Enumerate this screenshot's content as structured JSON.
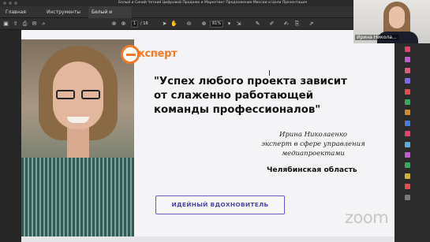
{
  "window": {
    "title": "Белый и Синий Четкий Цифровой Продажи и Маркетинг Предложение Миссии и Цели Презентация"
  },
  "tabs": [
    {
      "label": "Главная"
    },
    {
      "label": "Инструменты"
    },
    {
      "label": "Белый и Синий Ч...",
      "close": "×"
    }
  ],
  "toolbar": {
    "page_current": "1",
    "page_total": "/ 16",
    "zoom": "81%"
  },
  "slide": {
    "logo_word": "ксперт",
    "quote": "\"Успех любого проекта зависит от слаженно работающей команды профессионалов\"",
    "author_name": "Ирина Николаенко",
    "author_role": "эксперт в сфере управления медиапроектами",
    "region": "Челябинская область",
    "badge": "ИДЕЙНЫЙ ВДОХНОВИТЕЛЬ"
  },
  "webcam": {
    "participant_name": "Ирина Никола..."
  },
  "watermark": "zoom",
  "colors": {
    "accent_orange": "#f07a26",
    "badge_purple": "#4d46a8",
    "sidebar_icons": [
      "#e0446a",
      "#c05ad6",
      "#e35a78",
      "#7a6af0",
      "#e44d4d",
      "#3aa85a",
      "#d08a2a",
      "#4a7ad6",
      "#e0446a",
      "#5ab0d6",
      "#c05ad6",
      "#3aa85a",
      "#d0b030",
      "#e44d4d",
      "#7a7a7a"
    ]
  }
}
